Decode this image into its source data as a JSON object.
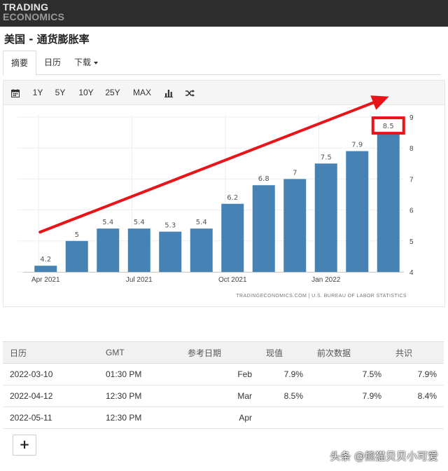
{
  "header": {
    "logo_line1": "TRADING",
    "logo_line2": "ECONOMICS"
  },
  "page": {
    "title": "美国 - 通货膨胀率"
  },
  "tabs": [
    {
      "label": "摘要",
      "active": true
    },
    {
      "label": "日历",
      "active": false
    },
    {
      "label": "下载",
      "active": false
    }
  ],
  "toolbar": {
    "calendar_icon": "calendar-icon",
    "ranges": [
      "1Y",
      "5Y",
      "10Y",
      "25Y",
      "MAX"
    ],
    "chart_type_icon": "bar-chart-icon",
    "compare_icon": "shuffle-icon"
  },
  "chart_data": {
    "type": "bar",
    "categories": [
      "2021-04",
      "2021-05",
      "2021-06",
      "2021-07",
      "2021-08",
      "2021-09",
      "2021-10",
      "2021-11",
      "2021-12",
      "2022-01",
      "2022-02",
      "2022-03"
    ],
    "values": [
      4.2,
      5,
      5.4,
      5.4,
      5.3,
      5.4,
      6.2,
      6.8,
      7,
      7.5,
      7.9,
      8.5
    ],
    "data_labels": [
      "4.2",
      "5",
      "5.4",
      "5.4",
      "5.3",
      "5.4",
      "6.2",
      "6.8",
      "7",
      "7.5",
      "7.9",
      "8.5"
    ],
    "x_tick_labels": [
      {
        "label": "Apr 2021",
        "index": 0
      },
      {
        "label": "Jul 2021",
        "index": 3
      },
      {
        "label": "Oct 2021",
        "index": 6
      },
      {
        "label": "Jan 2022",
        "index": 9
      }
    ],
    "y_ticks": [
      4,
      5,
      6,
      7,
      8,
      9
    ],
    "ylim": [
      4,
      9
    ],
    "y_axis_side": "right",
    "grid": true,
    "bar_color": "#4682b4",
    "source": "TRADINGECONOMICS.COM  |  U.S. BUREAU OF LABOR STATISTICS",
    "annotations": {
      "trend_arrow_color": "#e8141a",
      "highlight_box_index": 11,
      "highlight_color": "#e8141a"
    }
  },
  "calendar_table": {
    "headers": [
      "日历",
      "GMT",
      "参考日期",
      "现值",
      "前次数据",
      "共识"
    ],
    "rows": [
      [
        "2022-03-10",
        "01:30 PM",
        "Feb",
        "7.9%",
        "7.5%",
        "7.9%"
      ],
      [
        "2022-04-12",
        "12:30 PM",
        "Mar",
        "8.5%",
        "7.9%",
        "8.4%"
      ],
      [
        "2022-05-11",
        "12:30 PM",
        "Apr",
        "",
        "",
        ""
      ]
    ]
  },
  "add_button": {
    "label": "+"
  },
  "watermark": {
    "text": "头条 @熊猫贝贝小可爱"
  }
}
